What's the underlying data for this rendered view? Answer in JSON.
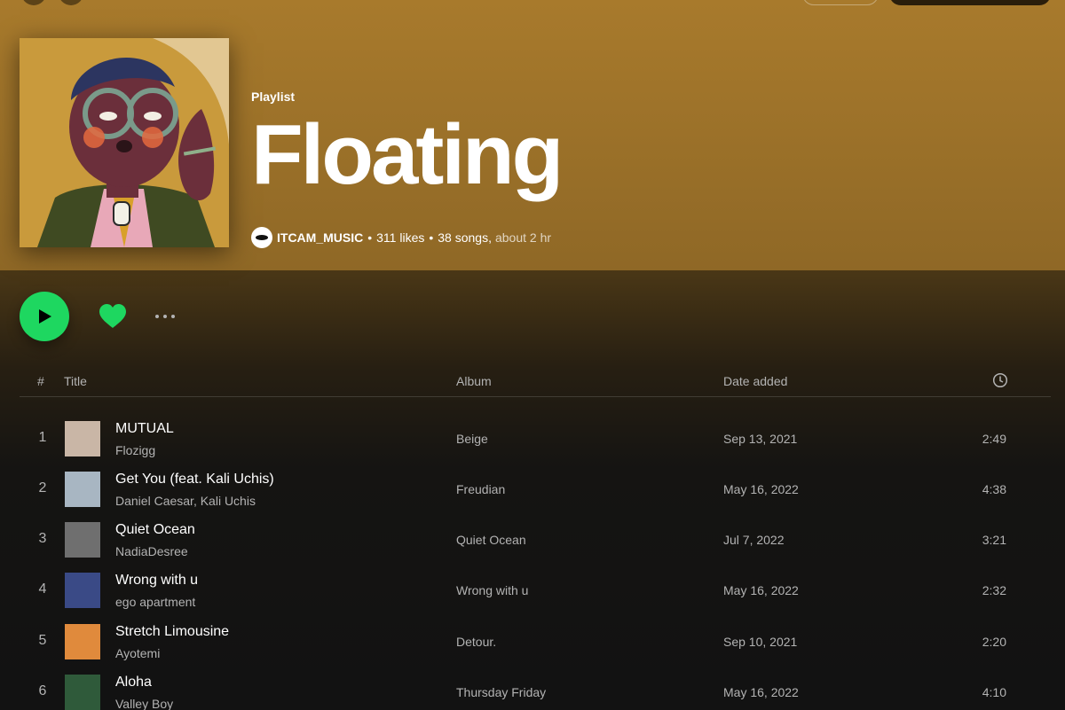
{
  "playlist": {
    "kind": "Playlist",
    "title": "Floating",
    "owner": "ITCAM_MUSIC",
    "likes": "311 likes",
    "songs": "38 songs,",
    "duration": "about 2 hr",
    "separator": "•"
  },
  "colors": {
    "header": "#a87a2c",
    "accent": "#1ed760",
    "background": "#121212"
  },
  "actions": {
    "play_icon": "play-icon",
    "like_icon": "heart-icon",
    "more_icon": "more-icon"
  },
  "table": {
    "headers": {
      "number": "#",
      "title": "Title",
      "album": "Album",
      "date_added": "Date added",
      "duration_icon": "clock-icon"
    },
    "rows": [
      {
        "number": "1",
        "title": "MUTUAL",
        "artist": "Flozigg",
        "album": "Beige",
        "date_added": "Sep 13, 2021",
        "duration": "2:49",
        "thumb_color": "#c9b6a6"
      },
      {
        "number": "2",
        "title": "Get You (feat. Kali Uchis)",
        "artist": "Daniel Caesar, Kali Uchis",
        "album": "Freudian",
        "date_added": "May 16, 2022",
        "duration": "4:38",
        "thumb_color": "#a8b6c2"
      },
      {
        "number": "3",
        "title": "Quiet Ocean",
        "artist": "NadiaDesree",
        "album": "Quiet Ocean",
        "date_added": "Jul 7, 2022",
        "duration": "3:21",
        "thumb_color": "#6f6f6f"
      },
      {
        "number": "4",
        "title": "Wrong with u",
        "artist": "ego apartment",
        "album": "Wrong with u",
        "date_added": "May 16, 2022",
        "duration": "2:32",
        "thumb_color": "#3a4a86"
      },
      {
        "number": "5",
        "title": "Stretch Limousine",
        "artist": "Ayotemi",
        "album": "Detour.",
        "date_added": "Sep 10, 2021",
        "duration": "2:20",
        "thumb_color": "#e08a3c"
      },
      {
        "number": "6",
        "title": "Aloha",
        "artist": "Valley Boy",
        "album": "Thursday Friday",
        "date_added": "May 16, 2022",
        "duration": "4:10",
        "thumb_color": "#2f5a3a"
      }
    ]
  }
}
